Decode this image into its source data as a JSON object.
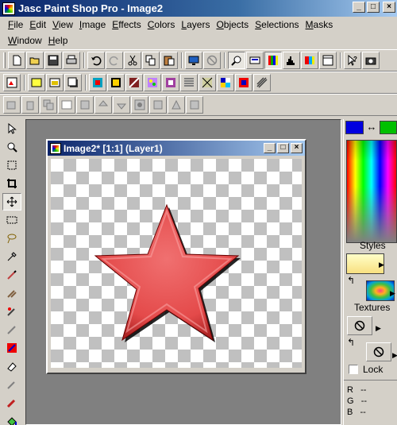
{
  "app": {
    "title": "Jasc Paint Shop Pro - Image2",
    "window_buttons": {
      "minimize": "_",
      "maximize": "□",
      "close": "×"
    }
  },
  "menubar": {
    "row1": [
      {
        "label": "File",
        "accel": "F",
        "rest": "ile"
      },
      {
        "label": "Edit",
        "accel": "E",
        "rest": "dit"
      },
      {
        "label": "View",
        "accel": "V",
        "rest": "iew"
      },
      {
        "label": "Image",
        "accel": "I",
        "rest": "mage"
      },
      {
        "label": "Effects",
        "accel": "E",
        "rest": "ffects"
      },
      {
        "label": "Colors",
        "accel": "C",
        "rest": "olors"
      },
      {
        "label": "Layers",
        "accel": "L",
        "rest": "ayers"
      },
      {
        "label": "Objects",
        "accel": "O",
        "rest": "bjects"
      },
      {
        "label": "Selections",
        "accel": "S",
        "rest": "elections"
      },
      {
        "label": "Masks",
        "accel": "M",
        "rest": "asks"
      }
    ],
    "row2": [
      {
        "label": "Window",
        "accel": "W",
        "rest": "indow"
      },
      {
        "label": "Help",
        "accel": "H",
        "rest": "elp"
      }
    ]
  },
  "document": {
    "title": "Image2* [1:1] (Layer1)",
    "shape": "star",
    "shape_color": "#e44a4a"
  },
  "palette": {
    "foreground_color": "#0000e0",
    "background_color": "#00c000",
    "swap_glyph": "↔",
    "styles_label": "Styles",
    "textures_label": "Textures",
    "lock_label": "Lock",
    "rgb": [
      {
        "channel": "R",
        "value": "--"
      },
      {
        "channel": "G",
        "value": "--"
      },
      {
        "channel": "B",
        "value": "--"
      }
    ]
  },
  "colors": {
    "titlebar_start": "#0a246a",
    "titlebar_end": "#a6caf0",
    "face": "#d4d0c8",
    "workspace": "#808080"
  }
}
